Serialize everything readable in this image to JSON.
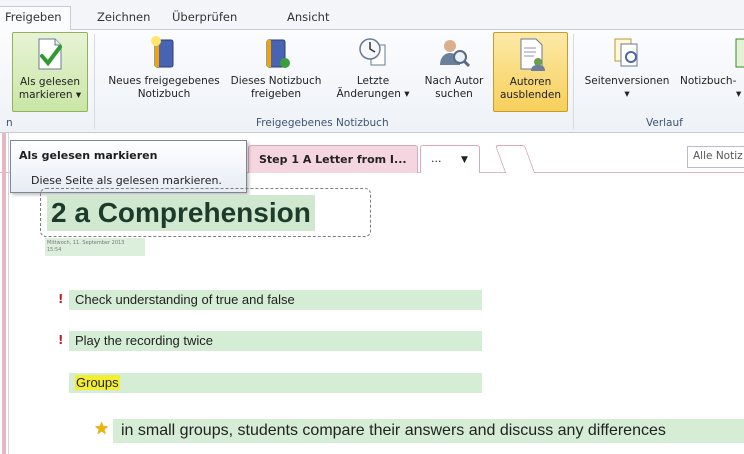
{
  "ribbon_tabs": [
    "Freigeben",
    "Zeichnen",
    "Überprüfen",
    "Ansicht"
  ],
  "ribbon": {
    "mark_read": {
      "line1": "Als gelesen",
      "line2": "markieren ▾"
    },
    "new_shared": {
      "line1": "Neues freigegebenes",
      "line2": "Notizbuch"
    },
    "share_this": {
      "line1": "Dieses Notizbuch",
      "line2": "freigeben"
    },
    "recent": {
      "line1": "Letzte",
      "line2": "Änderungen ▾"
    },
    "by_author": {
      "line1": "Nach Autor",
      "line2": "suchen"
    },
    "hide_authors": {
      "line1": "Autoren",
      "line2": "ausblenden"
    },
    "page_versions": {
      "line1": "Seitenversionen",
      "line2": "▾"
    },
    "notebook": {
      "line1": "Notizbuch-",
      "line2": "▾"
    },
    "group_left_label": "n",
    "group_shared_label": "Freigegebenes Notizbuch",
    "group_history_label": "Verlauf"
  },
  "page_tabs": {
    "active": "Step 1 A Letter from I...",
    "more": "...",
    "search_placeholder": "Alle Notiz"
  },
  "tooltip": {
    "title": "Als gelesen markieren",
    "description": "Diese Seite als gelesen markieren."
  },
  "page": {
    "title": "2 a Comprehension",
    "date": "Mittwoch, 11. September 2013",
    "time": "15:54",
    "items": [
      "Check understanding of true and false",
      "Play the recording twice"
    ],
    "group_label": "Groups",
    "sub_item": "in small groups, students compare their answers and discuss any differences"
  },
  "colors": {
    "highlight_green": "#d5ecd5",
    "highlight_yellow": "#f3ef2e",
    "flag_red": "#cc1d1d",
    "selected_button_green": "#c9e6a6",
    "selected_button_gold": "#f7cf5b"
  }
}
